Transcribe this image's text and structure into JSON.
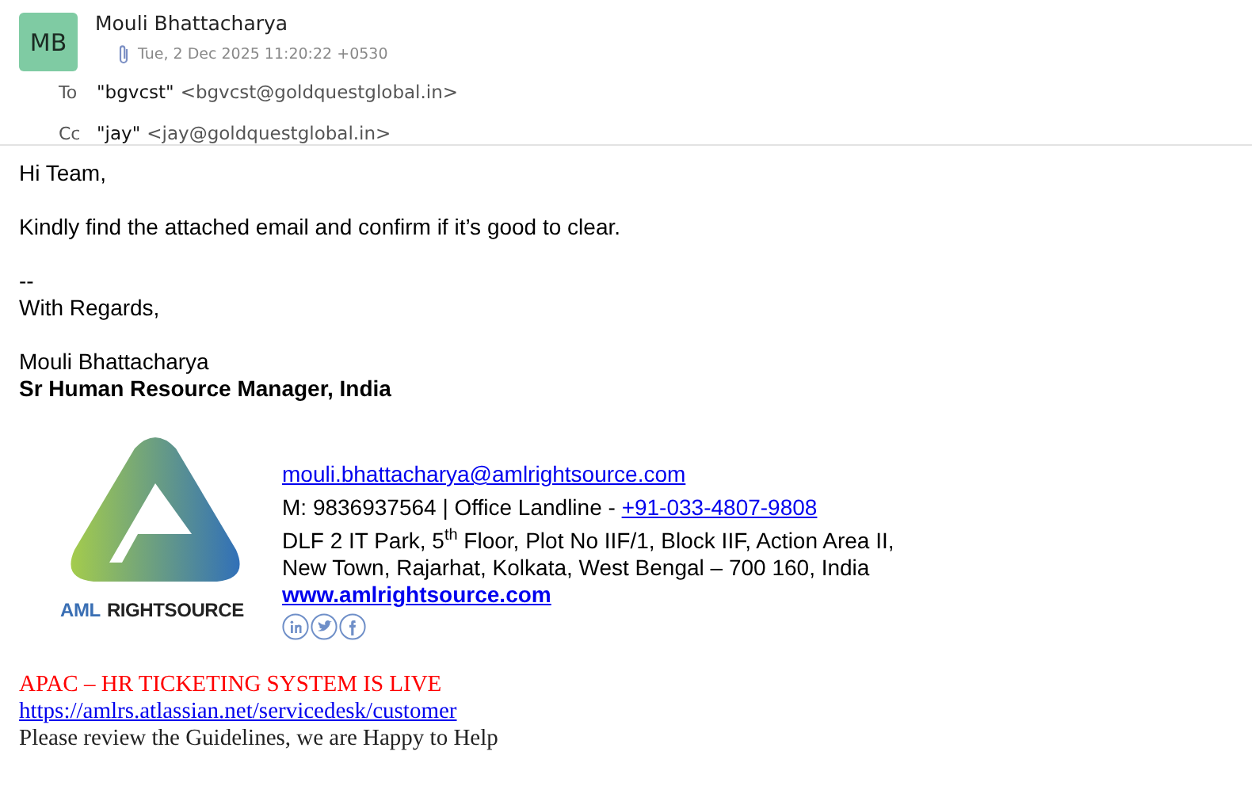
{
  "sender": {
    "initials": "MB",
    "name": "Mouli Bhattacharya",
    "date": "Tue, 2 Dec 2025 11:20:22 +0530"
  },
  "recipients": [
    {
      "label": "To",
      "name": "\"bgvcst\"",
      "address": "<bgvcst@goldquestglobal.in>"
    },
    {
      "label": "Cc",
      "name": "\"jay\"",
      "address": "<jay@goldquestglobal.in>"
    }
  ],
  "body": {
    "greeting": "Hi Team,",
    "message": "Kindly find the attached email and confirm if it’s good to clear.",
    "separator": "--",
    "closing": "With Regards,"
  },
  "signature": {
    "name": "Mouli Bhattacharya",
    "title": "Sr Human Resource Manager, India",
    "logo": {
      "prefix": "AML",
      "name": "RIGHTSOURCE"
    },
    "email": "mouli.bhattacharya@amlrightsource.com",
    "phone": "M: 9836937564 | Office Landline - ",
    "landline": "+91-033-4807-9808",
    "address_lines": [
      "DLF 2 IT Park, 5$^{th}$ Floor, Plot No IIF/1, Block IIF, Action Area II,",
      "New Town, Rajarhat, Kolkata, West Bengal – 700 160, India"
    ],
    "website": "www.amlrightsource.com"
  },
  "footer": {
    "announcement": "APAC – HR TICKETING SYSTEM IS LIVE",
    "link": "https://amlrs.atlassian.net/servicedesk/customer",
    "note": "Please review the Guidelines, we are Happy to Help"
  }
}
